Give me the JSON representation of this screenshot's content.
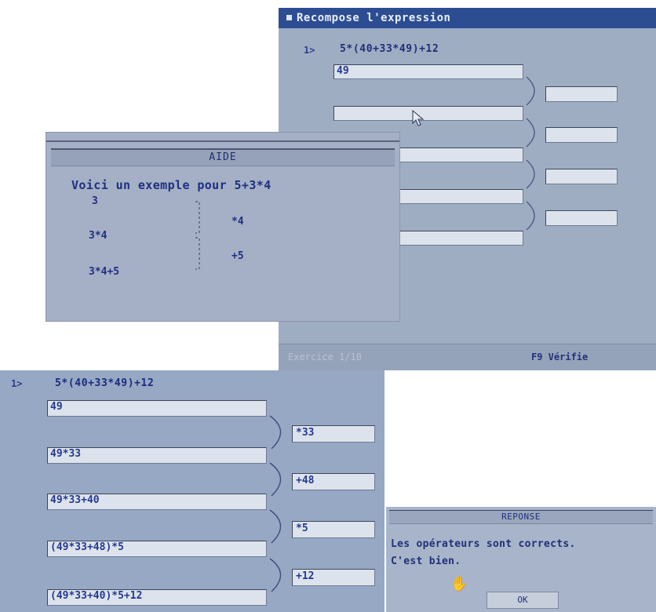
{
  "main_window": {
    "title": "Recompose l'expression",
    "question_number": "1>",
    "expression": "5*(40+33*49)+12",
    "fields": [
      "49",
      "",
      "",
      "",
      ""
    ],
    "operator_fields": [
      "",
      "",
      "",
      ""
    ],
    "status_left": "Exercice 1/10",
    "status_right": "F9  Vérifie"
  },
  "aide": {
    "title": "AIDE",
    "intro": "Voici un exemple pour 5+3*4",
    "steps": [
      "3",
      "3*4",
      "3*4+5"
    ],
    "operators": [
      "*4",
      "+5"
    ]
  },
  "completed": {
    "question_number": "1>",
    "expression": "5*(40+33*49)+12",
    "fields": [
      "49",
      "49*33",
      "49*33+40",
      "(49*33+48)*5",
      "(49*33+40)*5+12"
    ],
    "operator_fields": [
      "*33",
      "+48",
      "*5",
      "+12"
    ]
  },
  "reponse": {
    "title": "REPONSE",
    "line1": "Les opérateurs sont corrects.",
    "line2": "C'est bien.",
    "ok_label": "OK"
  },
  "colors": {
    "title_bar": "#2d4d93",
    "panel_bg": "#9fadc3",
    "text_blue": "#1f2f7a"
  }
}
